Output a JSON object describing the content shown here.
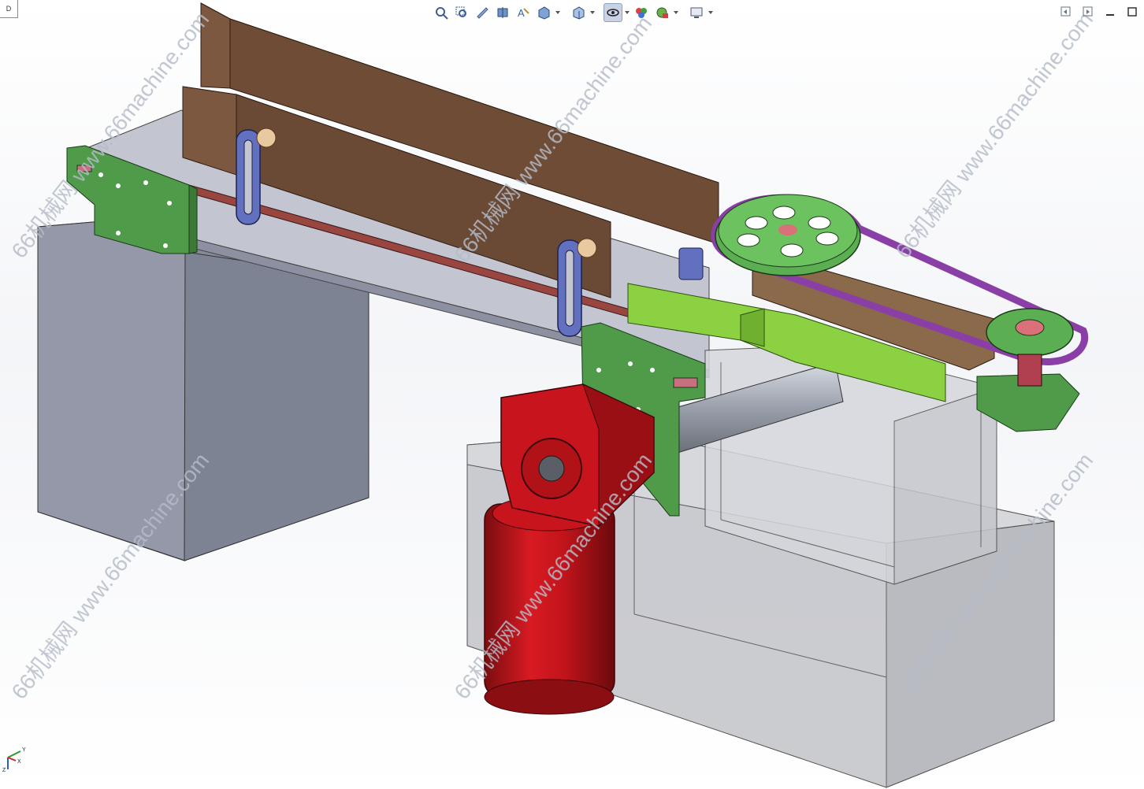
{
  "app": {
    "tab_marker": "D"
  },
  "toolbar": {
    "items": [
      {
        "icon": "zoom-to-fit-icon",
        "interactable": true
      },
      {
        "icon": "zoom-to-area-icon",
        "interactable": true
      },
      {
        "icon": "previous-view-icon",
        "interactable": true
      },
      {
        "icon": "section-view-icon",
        "interactable": true
      },
      {
        "icon": "dynamic-annotation-icon",
        "interactable": true
      },
      {
        "icon": "view-orientation-icon",
        "interactable": true,
        "dropdown": true
      },
      {
        "icon": "display-style-icon",
        "interactable": true,
        "dropdown": true
      },
      {
        "icon": "hide-show-items-icon",
        "interactable": true,
        "dropdown": true,
        "active": true
      },
      {
        "icon": "edit-appearance-icon",
        "interactable": true
      },
      {
        "icon": "apply-scene-icon",
        "interactable": true,
        "dropdown": true
      },
      {
        "icon": "view-settings-icon",
        "interactable": true,
        "dropdown": true
      }
    ],
    "accent": "#4a78b8"
  },
  "window_controls": [
    "restore-icon",
    "tile-icon",
    "minimize-icon",
    "maximize-icon"
  ],
  "watermark": {
    "text": "66机械网 www.66machine.com",
    "color": "#b5bcc8"
  },
  "triad": {
    "y_label": "Y",
    "x_label": "X",
    "z_label": "Z"
  },
  "colors": {
    "chute": "#6b4a35",
    "bracket": "#4f9b4a",
    "motor": "#c8141c",
    "pulley": "#5cae52",
    "belt": "#8a3fa6",
    "frame": "#7d8494",
    "glass": "#a9aab4"
  }
}
